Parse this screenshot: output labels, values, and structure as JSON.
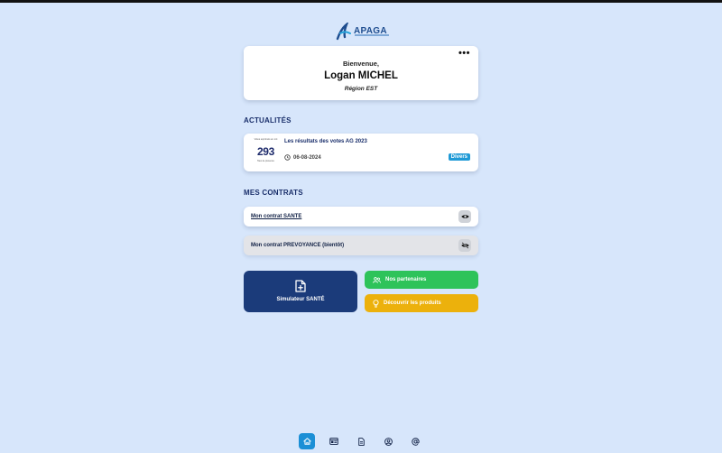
{
  "brand": {
    "name": "APAGA"
  },
  "welcome": {
    "greeting": "Bienvenue,",
    "name": "Logan MICHEL",
    "region": "Région EST",
    "menu_icon": "more-dots-icon"
  },
  "sections": {
    "news_title": "ACTUALITÉS",
    "contracts_title": "MES CONTRATS"
  },
  "news": [
    {
      "thumb_top": "Votes exprimés en ont",
      "thumb_number": "293",
      "thumb_bottom": "Taux de présence",
      "title": "Les résultats des votes AG 2023",
      "date": "06-08-2024",
      "badge": "Divers",
      "badge_color": "#1f9ad6"
    }
  ],
  "contracts": [
    {
      "label": "Mon contrat SANTE",
      "icon": "eye-icon",
      "enabled": true
    },
    {
      "label": "Mon contrat PREVOYANCE (bientôt)",
      "icon": "eye-off-icon",
      "enabled": false
    }
  ],
  "actions": {
    "simulator": {
      "label": "Simulateur SANTÉ",
      "icon": "file-plus-icon",
      "color": "#1b3b7a"
    },
    "partners": {
      "label": "Nos partenaires",
      "icon": "users-icon",
      "color": "#2ec35a"
    },
    "products": {
      "label": "Découvrir les produits",
      "icon": "lightbulb-icon",
      "color": "#ecb10c"
    }
  },
  "bottom_nav": [
    {
      "icon": "home-icon",
      "active": true
    },
    {
      "icon": "news-icon",
      "active": false
    },
    {
      "icon": "document-icon",
      "active": false
    },
    {
      "icon": "user-circle-icon",
      "active": false
    },
    {
      "icon": "at-sign-icon",
      "active": false
    }
  ],
  "colors": {
    "background": "#d7e6fb",
    "primary": "#1b3b7a",
    "accent": "#1b8fd6"
  }
}
